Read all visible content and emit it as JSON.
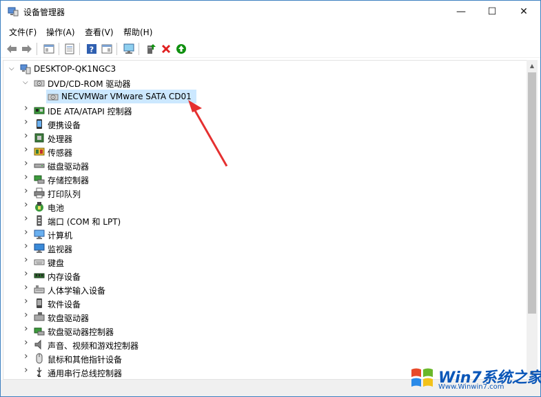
{
  "window": {
    "title": "设备管理器",
    "controls": {
      "minimize": "—",
      "maximize": "☐",
      "close": "✕"
    }
  },
  "menu": [
    "文件(F)",
    "操作(A)",
    "查看(V)",
    "帮助(H)"
  ],
  "toolbar_icons": [
    "back-icon",
    "forward-icon",
    "show-hide-tree-icon",
    "properties-icon",
    "help-icon",
    "view-icon",
    "monitor-icon",
    "update-driver-icon",
    "uninstall-icon",
    "enable-device-icon"
  ],
  "colors": {
    "selected": "#cce8ff",
    "accent_red": "#e02020",
    "accent_green": "#109010",
    "border": "#3c7fc0"
  },
  "tree": {
    "root": "DESKTOP-QK1NGC3",
    "items": [
      {
        "label": "DVD/CD-ROM 驱动器",
        "level": 1,
        "expanded": true,
        "icon": "dvd-icon"
      },
      {
        "label": "NECVMWar VMware SATA CD01",
        "level": 2,
        "selected": true,
        "icon": "dvd-icon"
      },
      {
        "label": "IDE ATA/ATAPI 控制器",
        "level": 1,
        "icon": "ide-controller-icon"
      },
      {
        "label": "便携设备",
        "level": 1,
        "icon": "portable-device-icon"
      },
      {
        "label": "处理器",
        "level": 1,
        "icon": "processor-icon"
      },
      {
        "label": "传感器",
        "level": 1,
        "icon": "sensor-icon"
      },
      {
        "label": "磁盘驱动器",
        "level": 1,
        "icon": "disk-drive-icon"
      },
      {
        "label": "存储控制器",
        "level": 1,
        "icon": "storage-controller-icon"
      },
      {
        "label": "打印队列",
        "level": 1,
        "icon": "printer-icon"
      },
      {
        "label": "电池",
        "level": 1,
        "icon": "battery-icon"
      },
      {
        "label": "端口 (COM 和 LPT)",
        "level": 1,
        "icon": "port-icon"
      },
      {
        "label": "计算机",
        "level": 1,
        "icon": "computer-icon"
      },
      {
        "label": "监视器",
        "level": 1,
        "icon": "monitor-icon"
      },
      {
        "label": "键盘",
        "level": 1,
        "icon": "keyboard-icon"
      },
      {
        "label": "内存设备",
        "level": 1,
        "icon": "memory-icon"
      },
      {
        "label": "人体学输入设备",
        "level": 1,
        "icon": "hid-icon"
      },
      {
        "label": "软件设备",
        "level": 1,
        "icon": "software-device-icon"
      },
      {
        "label": "软盘驱动器",
        "level": 1,
        "icon": "floppy-drive-icon"
      },
      {
        "label": "软盘驱动器控制器",
        "level": 1,
        "icon": "floppy-controller-icon"
      },
      {
        "label": "声音、视频和游戏控制器",
        "level": 1,
        "icon": "sound-icon"
      },
      {
        "label": "鼠标和其他指针设备",
        "level": 1,
        "icon": "mouse-icon"
      },
      {
        "label": "通用串行总线控制器",
        "level": 1,
        "icon": "usb-icon"
      }
    ]
  },
  "watermark": {
    "text": "Win7系统之家",
    "sub": "Www.Winwin7.com"
  }
}
